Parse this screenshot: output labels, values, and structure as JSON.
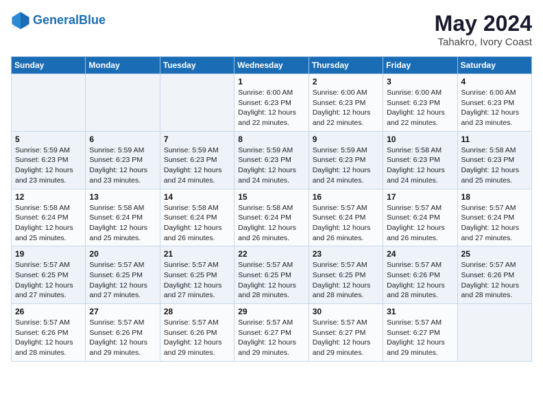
{
  "header": {
    "logo_line1": "General",
    "logo_line2": "Blue",
    "month_year": "May 2024",
    "location": "Tahakro, Ivory Coast"
  },
  "weekdays": [
    "Sunday",
    "Monday",
    "Tuesday",
    "Wednesday",
    "Thursday",
    "Friday",
    "Saturday"
  ],
  "weeks": [
    [
      {
        "day": "",
        "info": ""
      },
      {
        "day": "",
        "info": ""
      },
      {
        "day": "",
        "info": ""
      },
      {
        "day": "1",
        "info": "Sunrise: 6:00 AM\nSunset: 6:23 PM\nDaylight: 12 hours\nand 22 minutes."
      },
      {
        "day": "2",
        "info": "Sunrise: 6:00 AM\nSunset: 6:23 PM\nDaylight: 12 hours\nand 22 minutes."
      },
      {
        "day": "3",
        "info": "Sunrise: 6:00 AM\nSunset: 6:23 PM\nDaylight: 12 hours\nand 22 minutes."
      },
      {
        "day": "4",
        "info": "Sunrise: 6:00 AM\nSunset: 6:23 PM\nDaylight: 12 hours\nand 23 minutes."
      }
    ],
    [
      {
        "day": "5",
        "info": "Sunrise: 5:59 AM\nSunset: 6:23 PM\nDaylight: 12 hours\nand 23 minutes."
      },
      {
        "day": "6",
        "info": "Sunrise: 5:59 AM\nSunset: 6:23 PM\nDaylight: 12 hours\nand 23 minutes."
      },
      {
        "day": "7",
        "info": "Sunrise: 5:59 AM\nSunset: 6:23 PM\nDaylight: 12 hours\nand 24 minutes."
      },
      {
        "day": "8",
        "info": "Sunrise: 5:59 AM\nSunset: 6:23 PM\nDaylight: 12 hours\nand 24 minutes."
      },
      {
        "day": "9",
        "info": "Sunrise: 5:59 AM\nSunset: 6:23 PM\nDaylight: 12 hours\nand 24 minutes."
      },
      {
        "day": "10",
        "info": "Sunrise: 5:58 AM\nSunset: 6:23 PM\nDaylight: 12 hours\nand 24 minutes."
      },
      {
        "day": "11",
        "info": "Sunrise: 5:58 AM\nSunset: 6:23 PM\nDaylight: 12 hours\nand 25 minutes."
      }
    ],
    [
      {
        "day": "12",
        "info": "Sunrise: 5:58 AM\nSunset: 6:24 PM\nDaylight: 12 hours\nand 25 minutes."
      },
      {
        "day": "13",
        "info": "Sunrise: 5:58 AM\nSunset: 6:24 PM\nDaylight: 12 hours\nand 25 minutes."
      },
      {
        "day": "14",
        "info": "Sunrise: 5:58 AM\nSunset: 6:24 PM\nDaylight: 12 hours\nand 26 minutes."
      },
      {
        "day": "15",
        "info": "Sunrise: 5:58 AM\nSunset: 6:24 PM\nDaylight: 12 hours\nand 26 minutes."
      },
      {
        "day": "16",
        "info": "Sunrise: 5:57 AM\nSunset: 6:24 PM\nDaylight: 12 hours\nand 26 minutes."
      },
      {
        "day": "17",
        "info": "Sunrise: 5:57 AM\nSunset: 6:24 PM\nDaylight: 12 hours\nand 26 minutes."
      },
      {
        "day": "18",
        "info": "Sunrise: 5:57 AM\nSunset: 6:24 PM\nDaylight: 12 hours\nand 27 minutes."
      }
    ],
    [
      {
        "day": "19",
        "info": "Sunrise: 5:57 AM\nSunset: 6:25 PM\nDaylight: 12 hours\nand 27 minutes."
      },
      {
        "day": "20",
        "info": "Sunrise: 5:57 AM\nSunset: 6:25 PM\nDaylight: 12 hours\nand 27 minutes."
      },
      {
        "day": "21",
        "info": "Sunrise: 5:57 AM\nSunset: 6:25 PM\nDaylight: 12 hours\nand 27 minutes."
      },
      {
        "day": "22",
        "info": "Sunrise: 5:57 AM\nSunset: 6:25 PM\nDaylight: 12 hours\nand 28 minutes."
      },
      {
        "day": "23",
        "info": "Sunrise: 5:57 AM\nSunset: 6:25 PM\nDaylight: 12 hours\nand 28 minutes."
      },
      {
        "day": "24",
        "info": "Sunrise: 5:57 AM\nSunset: 6:26 PM\nDaylight: 12 hours\nand 28 minutes."
      },
      {
        "day": "25",
        "info": "Sunrise: 5:57 AM\nSunset: 6:26 PM\nDaylight: 12 hours\nand 28 minutes."
      }
    ],
    [
      {
        "day": "26",
        "info": "Sunrise: 5:57 AM\nSunset: 6:26 PM\nDaylight: 12 hours\nand 28 minutes."
      },
      {
        "day": "27",
        "info": "Sunrise: 5:57 AM\nSunset: 6:26 PM\nDaylight: 12 hours\nand 29 minutes."
      },
      {
        "day": "28",
        "info": "Sunrise: 5:57 AM\nSunset: 6:26 PM\nDaylight: 12 hours\nand 29 minutes."
      },
      {
        "day": "29",
        "info": "Sunrise: 5:57 AM\nSunset: 6:27 PM\nDaylight: 12 hours\nand 29 minutes."
      },
      {
        "day": "30",
        "info": "Sunrise: 5:57 AM\nSunset: 6:27 PM\nDaylight: 12 hours\nand 29 minutes."
      },
      {
        "day": "31",
        "info": "Sunrise: 5:57 AM\nSunset: 6:27 PM\nDaylight: 12 hours\nand 29 minutes."
      },
      {
        "day": "",
        "info": ""
      }
    ]
  ]
}
